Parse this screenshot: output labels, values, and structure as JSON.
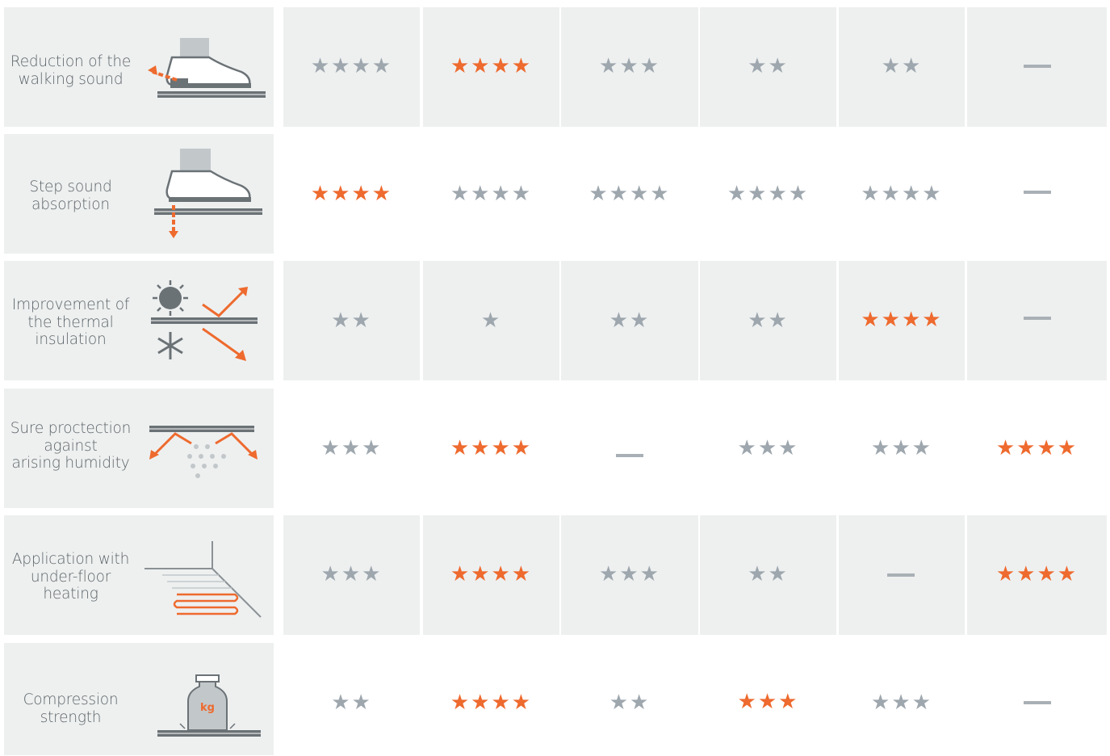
{
  "colors": {
    "star_orange": "#ee6a2e",
    "star_grey": "#9ea7ae",
    "cell_bg": "#eef0f0",
    "text": "#5d6468"
  },
  "rows": [
    {
      "label_lines": [
        "Reduction of the",
        "walking sound"
      ],
      "icon": "shoe-walking-sound-icon",
      "ratings": [
        {
          "stars": 4,
          "highlight": false
        },
        {
          "stars": 4,
          "highlight": true
        },
        {
          "stars": 3,
          "highlight": false
        },
        {
          "stars": 2,
          "highlight": false
        },
        {
          "stars": 2,
          "highlight": false
        },
        {
          "stars": 0,
          "highlight": false
        }
      ]
    },
    {
      "label_lines": [
        "Step sound",
        "absorption"
      ],
      "icon": "shoe-step-sound-icon",
      "ratings": [
        {
          "stars": 4,
          "highlight": true
        },
        {
          "stars": 4,
          "highlight": false
        },
        {
          "stars": 4,
          "highlight": false
        },
        {
          "stars": 4,
          "highlight": false
        },
        {
          "stars": 4,
          "highlight": false
        },
        {
          "stars": 0,
          "highlight": false
        }
      ]
    },
    {
      "label_lines": [
        "Improvement of",
        "the thermal",
        "insulation"
      ],
      "icon": "thermal-insulation-icon",
      "ratings": [
        {
          "stars": 2,
          "highlight": false
        },
        {
          "stars": 1,
          "highlight": false
        },
        {
          "stars": 2,
          "highlight": false
        },
        {
          "stars": 2,
          "highlight": false
        },
        {
          "stars": 4,
          "highlight": true
        },
        {
          "stars": 0,
          "highlight": false
        }
      ]
    },
    {
      "label_lines": [
        "Sure proctection",
        "against",
        "arising humidity"
      ],
      "icon": "humidity-protection-icon",
      "ratings": [
        {
          "stars": 3,
          "highlight": false
        },
        {
          "stars": 4,
          "highlight": true
        },
        {
          "stars": 0,
          "highlight": false
        },
        {
          "stars": 3,
          "highlight": false
        },
        {
          "stars": 3,
          "highlight": false
        },
        {
          "stars": 4,
          "highlight": true
        }
      ]
    },
    {
      "label_lines": [
        "Application with",
        "under-floor",
        "heating"
      ],
      "icon": "underfloor-heating-icon",
      "ratings": [
        {
          "stars": 3,
          "highlight": false
        },
        {
          "stars": 4,
          "highlight": true
        },
        {
          "stars": 3,
          "highlight": false
        },
        {
          "stars": 2,
          "highlight": false
        },
        {
          "stars": 0,
          "highlight": false
        },
        {
          "stars": 4,
          "highlight": true
        }
      ]
    },
    {
      "label_lines": [
        "Compression",
        "strength"
      ],
      "icon": "weight-kg-icon",
      "icon_text": "kg",
      "ratings": [
        {
          "stars": 2,
          "highlight": false
        },
        {
          "stars": 4,
          "highlight": true
        },
        {
          "stars": 2,
          "highlight": false
        },
        {
          "stars": 3,
          "highlight": true
        },
        {
          "stars": 3,
          "highlight": false
        },
        {
          "stars": 0,
          "highlight": false
        }
      ]
    }
  ]
}
